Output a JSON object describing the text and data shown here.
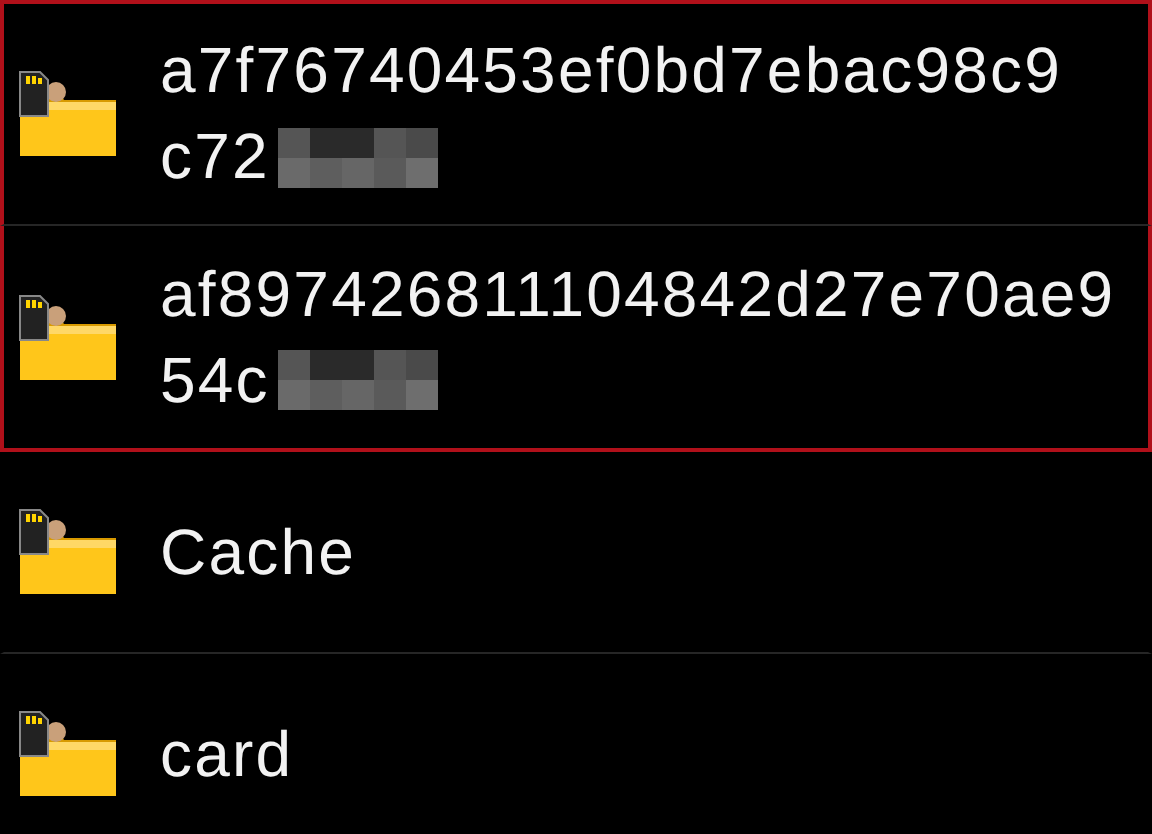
{
  "files": [
    {
      "lines": [
        "a7f76740453ef0bd7ebac98c9",
        "c72"
      ],
      "redacted": true,
      "selected": true
    },
    {
      "lines": [
        "af897426811104842d27e70ae9",
        "54c"
      ],
      "redacted": true,
      "selected": true
    },
    {
      "lines": [
        "Cache"
      ],
      "redacted": false,
      "selected": false
    },
    {
      "lines": [
        "card"
      ],
      "redacted": false,
      "selected": false
    }
  ]
}
